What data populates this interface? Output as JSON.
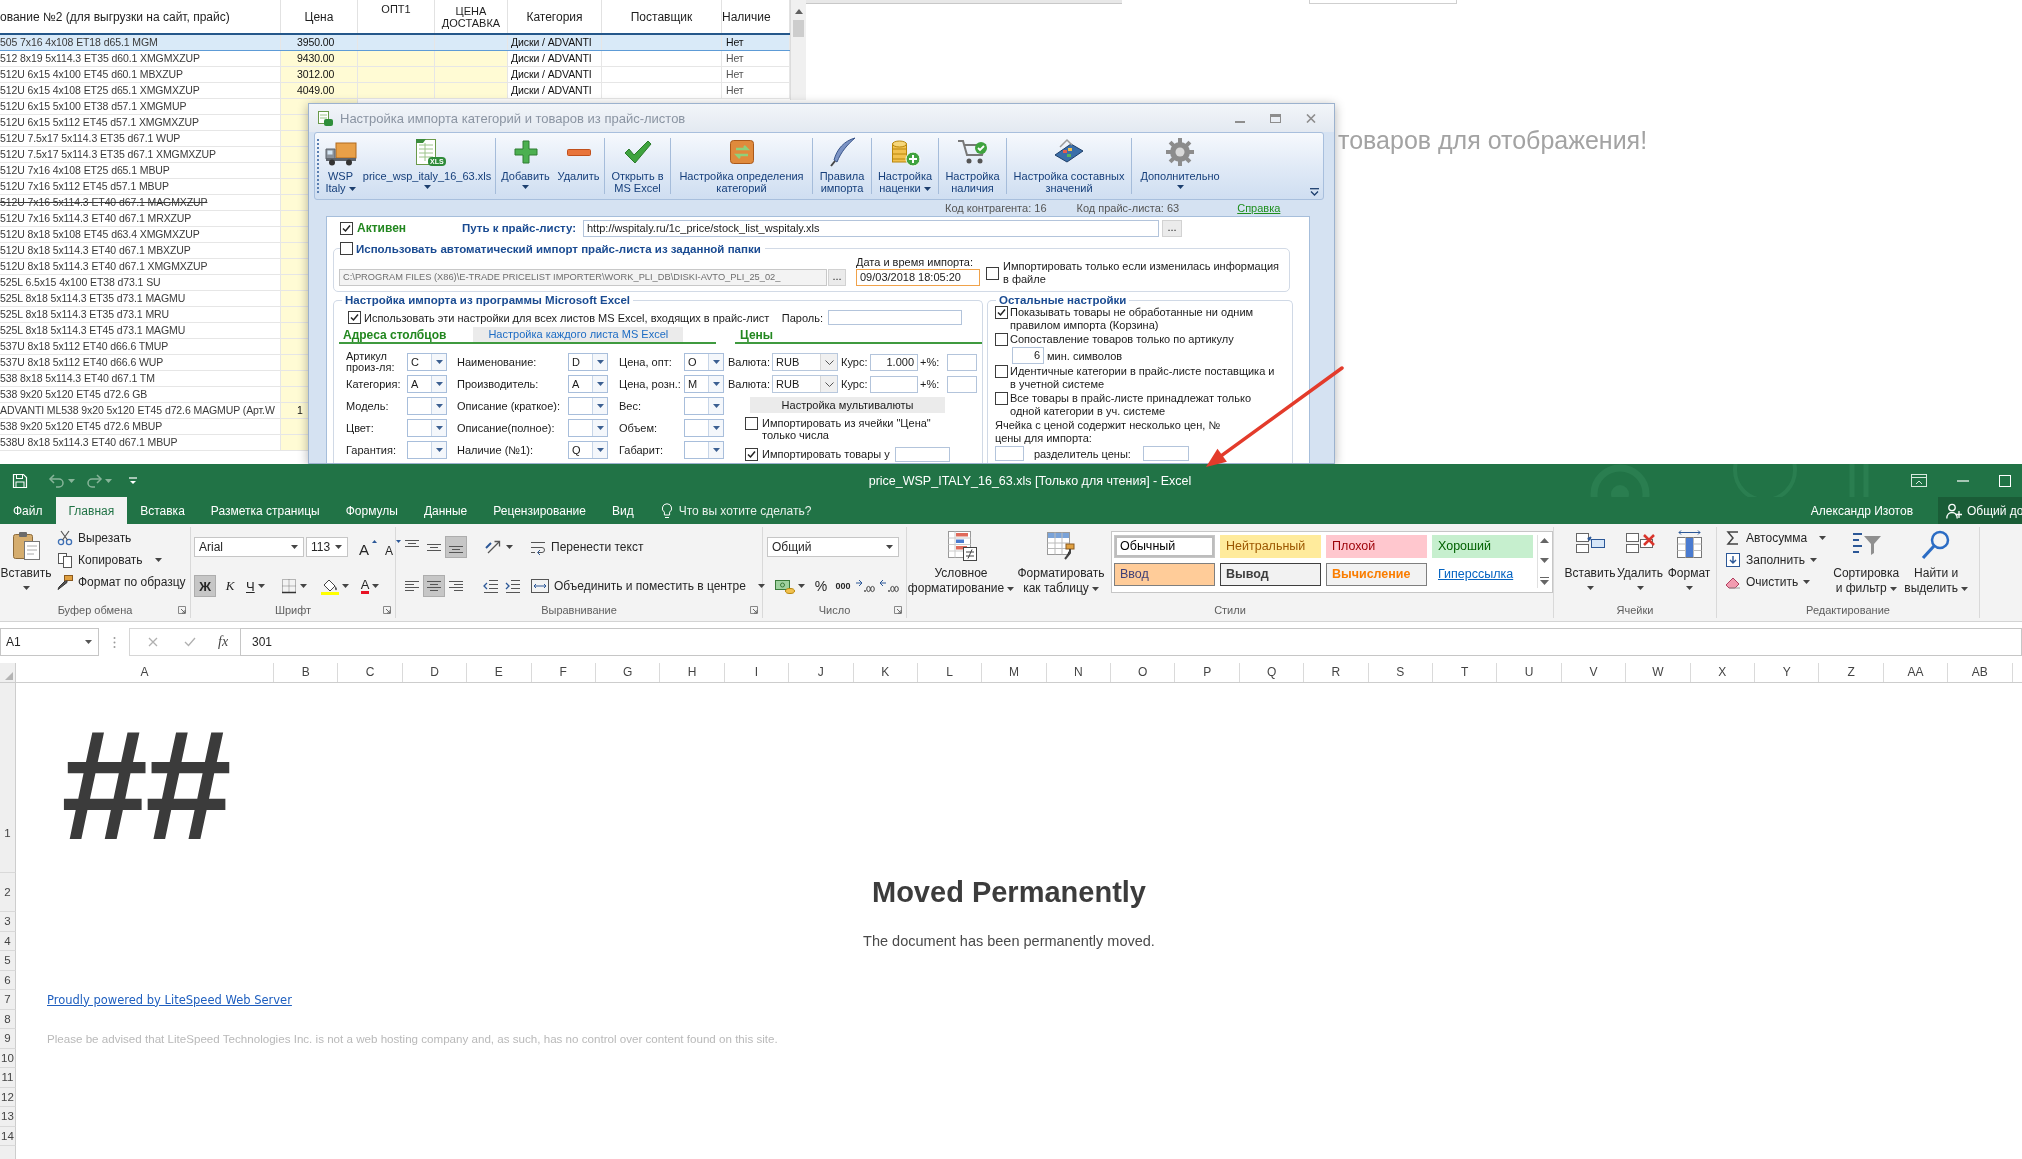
{
  "price_grid": {
    "columns": [
      "ование №2 (для выгрузки на сайт, прайс)",
      "Цена",
      "ОПТ1",
      "ЦЕНА ДОСТАВКА",
      "Категория",
      "Поставщик",
      "Наличие"
    ],
    "rows": [
      {
        "name": "505 7x16 4x108 ET18 d65.1 MGM",
        "price": "3950.00",
        "category": "Диски / ADVANTI",
        "availability": "Нет",
        "selected": true,
        "struck": false
      },
      {
        "name": "512 8x19 5x114.3 ET35 d60.1 XMGMXZUP",
        "price": "9430.00",
        "category": "Диски / ADVANTI",
        "availability": "Нет",
        "selected": false,
        "struck": false
      },
      {
        "name": "512U 6x15 4x100 ET45 d60.1 MBXZUP",
        "price": "3012.00",
        "category": "Диски / ADVANTI",
        "availability": "Нет",
        "selected": false,
        "struck": false
      },
      {
        "name": "512U 6x15 4x108 ET25 d65.1 XMGMXZUP",
        "price": "4049.00",
        "category": "Диски / ADVANTI",
        "availability": "Нет",
        "selected": false,
        "struck": false
      },
      {
        "name": "512U 6x15 5x100 ET38 d57.1 XMGMUP",
        "selected": false,
        "struck": false
      },
      {
        "name": "512U 6x15 5x112 ET45 d57.1 XMGMXZUP",
        "selected": false,
        "struck": false
      },
      {
        "name": "512U 7.5x17 5x114.3 ET35 d67.1 WUP",
        "selected": false,
        "struck": false
      },
      {
        "name": "512U 7.5x17 5x114.3 ET35 d67.1 XMGMXZUP",
        "selected": false,
        "struck": false
      },
      {
        "name": "512U 7x16 4x108 ET25 d65.1 MBUP",
        "selected": false,
        "struck": false
      },
      {
        "name": "512U 7x16 5x112 ET45 d57.1 MBUP",
        "selected": false,
        "struck": false
      },
      {
        "name": "512U 7x16 5x114.3 ET40 d67.1 MAGMXZUP",
        "selected": false,
        "struck": true
      },
      {
        "name": "512U 7x16 5x114.3 ET40 d67.1 MRXZUP",
        "selected": false,
        "struck": false
      },
      {
        "name": "512U 8x18 5x108 ET45 d63.4 XMGMXZUP",
        "selected": false,
        "struck": false
      },
      {
        "name": "512U 8x18 5x114.3 ET40 d67.1 MBXZUP",
        "selected": false,
        "struck": false
      },
      {
        "name": "512U 8x18 5x114.3 ET40 d67.1 XMGMXZUP",
        "selected": false,
        "struck": false
      },
      {
        "name": "525L 6.5x15 4x100 ET38 d73.1 SU",
        "selected": false,
        "struck": false
      },
      {
        "name": "525L 8x18 5x114.3 ET35 d73.1 MAGMU",
        "selected": false,
        "struck": false
      },
      {
        "name": "525L 8x18 5x114.3 ET35 d73.1 MRU",
        "selected": false,
        "struck": false
      },
      {
        "name": "525L 8x18 5x114.3 ET45 d73.1 MAGMU",
        "selected": false,
        "struck": false
      },
      {
        "name": "537U 8x18 5x112 ET40 d66.6 TMUP",
        "selected": false,
        "struck": false
      },
      {
        "name": "537U 8x18 5x112 ET40 d66.6 WUP",
        "selected": false,
        "struck": false
      },
      {
        "name": "538 8x18 5x114.3 ET40 d67.1 TM",
        "selected": false,
        "struck": false
      },
      {
        "name": "538 9x20 5x120 ET45 d72.6 GB",
        "selected": false,
        "struck": false
      },
      {
        "name": "ADVANTI ML538 9x20 5x120 ET45 d72.6 MAGMUP (Арт.W",
        "price": "1",
        "selected": false,
        "struck": false
      },
      {
        "name": "538 9x20 5x120 ET45 d72.6 MBUP",
        "selected": false,
        "struck": false
      },
      {
        "name": "538U 8x18 5x114.3 ET40 d67.1 MBUP",
        "selected": false,
        "struck": false
      }
    ]
  },
  "background_text": "товаров для отображения!",
  "import_dialog": {
    "title": "Настройка импорта категорий и товаров из прайс-листов",
    "toolbar": [
      {
        "label": "WSP\nItaly",
        "dropdown": true
      },
      {
        "label": "price_wsp_italy_16_63.xls",
        "badge": "XLS",
        "dropdown": true
      },
      {
        "label": "Добавить",
        "dropdown": true
      },
      {
        "label": "Удалить",
        "dropdown": false
      },
      {
        "label": "Открыть в\nMS Excel",
        "dropdown": false
      },
      {
        "label": "Настройка определения\nкатегорий",
        "dropdown": false
      },
      {
        "label": "Правила\nимпорта",
        "dropdown": false
      },
      {
        "label": "Настройка\nнаценки",
        "dropdown": true
      },
      {
        "label": "Настройка\nналичия",
        "dropdown": false
      },
      {
        "label": "Настройка составных\nзначений",
        "dropdown": false
      },
      {
        "label": "Дополнительно",
        "dropdown": true
      }
    ],
    "contractor_code": "Код контрагента: 16",
    "price_list_code": "Код прайс-листа: 63",
    "help_link": "Справка",
    "active": {
      "label": "Активен",
      "checked": true
    },
    "path": {
      "label": "Путь к прайс-листу:",
      "value": "http://wspitaly.ru/1c_price/stock_list_wspitaly.xls",
      "browse": "..."
    },
    "auto_import": {
      "label": "Использовать автоматический импорт прайс-листа из заданной папки",
      "checked": false,
      "folder": "C:\\PROGRAM FILES (X86)\\E-TRADE PRICELIST IMPORTER\\WORK_PLI_DB\\DISKI-AVTO_PLI_25_02_",
      "browse": "...",
      "date_label": "Дата и время импорта:",
      "date_value": "09/03/2018 18:05:20",
      "only_changed": {
        "label": "Импортировать только если изменилась информация в файле",
        "checked": false
      }
    },
    "excel_settings": {
      "title": "Настройка импорта из программы Microsoft Excel",
      "all_sheets": {
        "label": "Использовать эти настройки для всех листов MS Excel, входящих в прайс-лист",
        "checked": true
      },
      "password_label": "Пароль:",
      "tabs": [
        {
          "label": "Адреса столбцов",
          "selected": true
        },
        {
          "label": "Настройка каждого листа MS Excel",
          "selected": false
        }
      ],
      "column_fields": [
        {
          "label": "Артикул\nпроиз-ля:",
          "value": "C"
        },
        {
          "label": "Наименование:",
          "value": "D"
        },
        {
          "label": "Цена, опт:",
          "value": "O"
        },
        {
          "label": "Категория:",
          "value": "A"
        },
        {
          "label": "Производитель:",
          "value": "A"
        },
        {
          "label": "Цена, розн.:",
          "value": "M"
        },
        {
          "label": "Модель:"
        },
        {
          "label": "Описание (краткое):"
        },
        {
          "label": "Вес:"
        },
        {
          "label": "Цвет:"
        },
        {
          "label": "Описание(полное):"
        },
        {
          "label": "Объем:"
        },
        {
          "label": "Гарантия:"
        },
        {
          "label": "Наличие (№1):",
          "value": "Q"
        },
        {
          "label": "Габарит:"
        }
      ],
      "prices": {
        "title": "Цены",
        "currencies": [
          {
            "label": "Валюта:",
            "value": "RUB",
            "rate_label": "Курс:",
            "rate": "1.000",
            "markup_label": "+%:"
          },
          {
            "label": "Валюта:",
            "value": "RUB",
            "rate_label": "Курс:",
            "markup_label": "+%:"
          }
        ],
        "multicurrency_button": "Настройка мультивалюты",
        "numbers_only": {
          "label": "Импортировать из ячейки \"Цена\" только числа",
          "checked": false
        },
        "min_price": {
          "label": "Импортировать товары у",
          "checked": true
        }
      }
    },
    "other_settings": {
      "title": "Остальные настройки",
      "options": [
        {
          "kind": "checkbox",
          "label": "Показывать товары не обработанные ни одним правилом импорта (Корзина)",
          "checked": true
        },
        {
          "kind": "checkbox",
          "label": "Сопоставление товаров только по артикулу",
          "checked": false,
          "min_chars": "6",
          "min_chars_label": "мин. символов"
        },
        {
          "kind": "checkbox",
          "label": "Идентичные категории в прайс-листе поставщика и в учетной системе",
          "checked": false
        },
        {
          "kind": "checkbox",
          "label": "Все товары в прайс-листе принадлежат только одной категории в уч. системе",
          "checked": false
        },
        {
          "kind": "multi_price",
          "label": "Ячейка с ценой содержит несколько цен, № цены для импорта:",
          "separator_label": "разделитель цены:"
        }
      ]
    }
  },
  "excel": {
    "title": "price_WSP_ITALY_16_63.xls [Только для чтения] - Excel",
    "tabs": [
      {
        "label": "Файл",
        "selected": false
      },
      {
        "label": "Главная",
        "selected": true
      },
      {
        "label": "Вставка",
        "selected": false
      },
      {
        "label": "Разметка страницы",
        "selected": false
      },
      {
        "label": "Формулы",
        "selected": false
      },
      {
        "label": "Данные",
        "selected": false
      },
      {
        "label": "Рецензирование",
        "selected": false
      },
      {
        "label": "Вид",
        "selected": false
      }
    ],
    "tell_me": "Что вы хотите сделать?",
    "user": "Александр Изотов",
    "share": "Общий до",
    "clipboard": {
      "paste": "Вставить",
      "cut": "Вырезать",
      "copy": "Копировать",
      "format_painter": "Формат по образцу",
      "group_label": "Буфер обмена"
    },
    "font": {
      "name": "Arial",
      "size": "113",
      "grow": "A",
      "shrink": "A",
      "bold": {
        "label": "Ж",
        "on": true
      },
      "italic": {
        "label": "К",
        "on": false
      },
      "underline": {
        "label": "Ч",
        "on": false
      },
      "font_color": "A",
      "group_label": "Шрифт"
    },
    "alignment": {
      "vertical": [
        {
          "selected": false
        },
        {
          "selected": false
        },
        {
          "selected": true
        }
      ],
      "horizontal": [
        {
          "selected": false
        },
        {
          "selected": true
        },
        {
          "selected": false
        }
      ],
      "wrap_text": "Перенести текст",
      "merge": "Объединить и поместить в центре",
      "group_label": "Выравнивание"
    },
    "number": {
      "format": "Общий",
      "percent": "%",
      "thousands": "000",
      "group_label": "Число"
    },
    "styles": {
      "conditional": "Условное\nформатирование",
      "as_table": "Форматировать\nкак таблицу",
      "gallery": [
        {
          "label": "Обычный",
          "kind": "normal",
          "selected": true
        },
        {
          "label": "Нейтральный",
          "kind": "neutral",
          "selected": false
        },
        {
          "label": "Плохой",
          "kind": "bad",
          "selected": false
        },
        {
          "label": "Хороший",
          "kind": "good",
          "selected": false
        },
        {
          "label": "Ввод",
          "kind": "input",
          "selected": false
        },
        {
          "label": "Вывод",
          "kind": "output",
          "selected": false
        },
        {
          "label": "Вычисление",
          "kind": "calculation",
          "selected": false
        },
        {
          "label": "Гиперссылка",
          "kind": "hyperlink",
          "selected": false
        }
      ],
      "group_label": "Стили"
    },
    "cells": {
      "buttons": [
        "Вставить",
        "Удалить",
        "Формат"
      ],
      "group_label": "Ячейки"
    },
    "editing": {
      "autosum": "Автосумма",
      "fill": "Заполнить",
      "clear": "Очистить",
      "sort": "Сортировка\nи фильтр",
      "find": "Найти и\nвыделить",
      "group_label": "Редактирование"
    },
    "name_box": "A1",
    "fx": "fx",
    "formula": "301",
    "columns": [
      "A",
      "B",
      "C",
      "D",
      "E",
      "F",
      "G",
      "H",
      "I",
      "J",
      "K",
      "L",
      "M",
      "N",
      "O",
      "P",
      "Q",
      "R",
      "S",
      "T",
      "U",
      "V",
      "W",
      "X",
      "Y",
      "Z",
      "AA",
      "AB"
    ],
    "rows": [
      "1",
      "2",
      "3",
      "4",
      "5",
      "6",
      "7",
      "8",
      "9",
      "10",
      "11",
      "12",
      "13",
      "14"
    ],
    "sheet": {
      "a1": "##",
      "heading": "Moved Permanently",
      "message": "The document has been permanently moved.",
      "link": "Proudly powered by LiteSpeed Web Server",
      "note": "Please be advised that LiteSpeed Technologies Inc. is not a web hosting company and, as such, has no control over content found on this site."
    }
  }
}
